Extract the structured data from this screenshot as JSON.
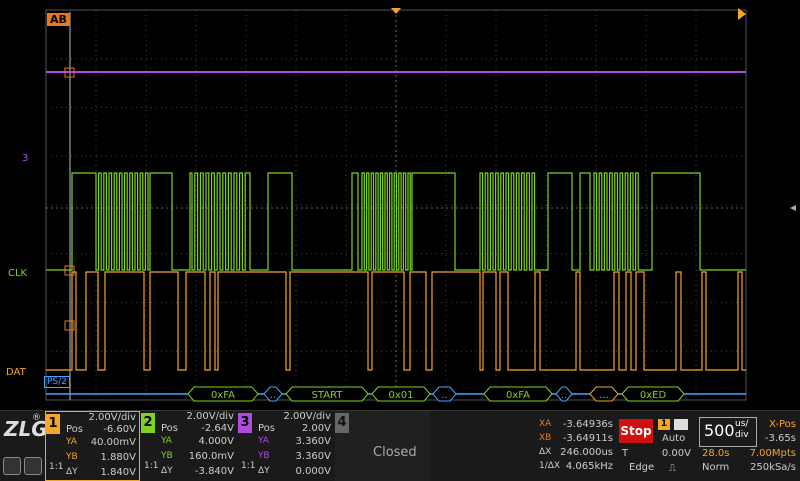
{
  "scope": {
    "ab_marker": "AB",
    "channel_labels": {
      "ch3": "3",
      "clk": "CLK",
      "dat": "DAT"
    },
    "decoder_tag": "PS/2",
    "decode_frames": [
      "0xFA",
      "..",
      "START",
      "0x01",
      "..",
      "0xFA",
      "..",
      "...",
      "0xED"
    ],
    "colors": {
      "ch1": "#f5a623",
      "ch2": "#7ed321",
      "ch3": "#b04ae0",
      "decode": "#7ed321",
      "ab": "#e87722",
      "grid": "#555555",
      "cursor": "#bbbbbb",
      "bus": "#4aa3ff"
    }
  },
  "brand": {
    "logo": "ZLG",
    "registered": "®"
  },
  "channels": [
    {
      "num": "1",
      "scale": "2.00V/div",
      "pos_label": "Pos",
      "pos": "-6.60V",
      "ya_label": "YA",
      "ya": "40.00mV",
      "yb_label": "YB",
      "yb": "1.880V",
      "dy_label": "ΔY",
      "dy": "1.840V",
      "coupling": "1:1",
      "color": "#f5a623"
    },
    {
      "num": "2",
      "scale": "2.00V/div",
      "pos_label": "Pos",
      "pos": "-2.64V",
      "ya_label": "YA",
      "ya": "4.000V",
      "yb_label": "YB",
      "yb": "160.0mV",
      "dy_label": "ΔY",
      "dy": "-3.840V",
      "coupling": "1:1",
      "color": "#7ed321"
    },
    {
      "num": "3",
      "scale": "2.00V/div",
      "pos_label": "Pos",
      "pos": "2.00V",
      "ya_label": "YA",
      "ya": "3.360V",
      "yb_label": "YB",
      "yb": "3.360V",
      "dy_label": "ΔY",
      "dy": "0.000V",
      "coupling": "1:1",
      "color": "#b04ae0"
    },
    {
      "num": "4",
      "status": "Closed",
      "color": "#888888"
    }
  ],
  "cursors": {
    "xa_label": "XA",
    "xa": "-3.64936s",
    "xb_label": "XB",
    "xb": "-3.64911s",
    "dx_label": "ΔX",
    "dx": "246.000us",
    "inv_label": "1/ΔX",
    "inv": "4.065kHz"
  },
  "trigger": {
    "state": "Stop",
    "source": "1",
    "mode": "Auto",
    "t_label": "T",
    "level": "0.00V",
    "type": "Edge"
  },
  "timebase": {
    "value": "500",
    "unit_top": "us/",
    "unit_bottom": "div",
    "xpos_label": "X-Pos",
    "xpos": "-3.65s",
    "time": "28.0s",
    "mem": "7.00Mpts",
    "acq": "Norm",
    "rate": "250kSa/s"
  }
}
